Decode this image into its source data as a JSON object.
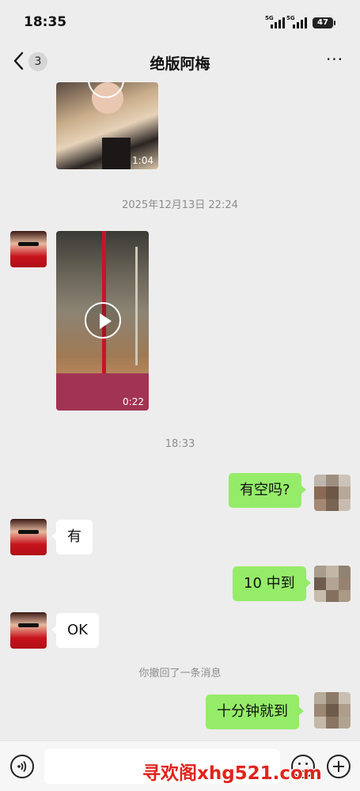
{
  "status_bar": {
    "time": "18:35",
    "signal_1": "5G",
    "signal_2": "5G",
    "battery": "47"
  },
  "header": {
    "unread_count": "3",
    "title": "绝版阿梅",
    "more_icon": "more-dots-icon"
  },
  "messages": [
    {
      "type": "video",
      "side": "left",
      "duration": "1:04"
    },
    {
      "type": "timestamp",
      "text": "2025年12月13日 22:24"
    },
    {
      "type": "video",
      "side": "left",
      "duration": "0:22"
    },
    {
      "type": "timestamp",
      "text": "18:33"
    },
    {
      "type": "text",
      "side": "right",
      "text": "有空吗?"
    },
    {
      "type": "text",
      "side": "left",
      "text": "有"
    },
    {
      "type": "text",
      "side": "right",
      "text": "10 中到"
    },
    {
      "type": "text",
      "side": "left",
      "text": "OK"
    },
    {
      "type": "system",
      "text": "你撤回了一条消息"
    },
    {
      "type": "text",
      "side": "right",
      "text": "十分钟就到"
    }
  ],
  "input_bar": {
    "voice_icon": "voice-icon",
    "emoji_icon": "emoji-icon",
    "plus_icon": "plus-icon"
  },
  "watermark": "寻欢阁xhg521.com",
  "colors": {
    "background": "#ededed",
    "outgoing_bubble": "#95ec69",
    "incoming_bubble": "#ffffff",
    "watermark": "#e0231c"
  }
}
